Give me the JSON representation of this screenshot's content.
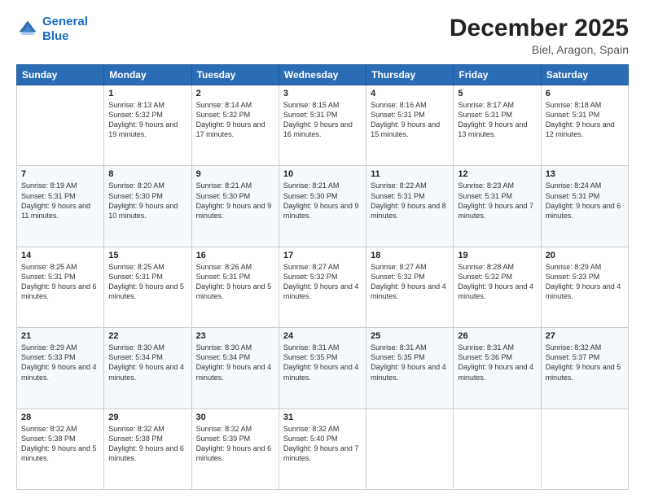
{
  "logo": {
    "line1": "General",
    "line2": "Blue"
  },
  "title": "December 2025",
  "subtitle": "Biel, Aragon, Spain",
  "days_header": [
    "Sunday",
    "Monday",
    "Tuesday",
    "Wednesday",
    "Thursday",
    "Friday",
    "Saturday"
  ],
  "weeks": [
    [
      {
        "day": "",
        "sunrise": "",
        "sunset": "",
        "daylight": ""
      },
      {
        "day": "1",
        "sunrise": "Sunrise: 8:13 AM",
        "sunset": "Sunset: 5:32 PM",
        "daylight": "Daylight: 9 hours and 19 minutes."
      },
      {
        "day": "2",
        "sunrise": "Sunrise: 8:14 AM",
        "sunset": "Sunset: 5:32 PM",
        "daylight": "Daylight: 9 hours and 17 minutes."
      },
      {
        "day": "3",
        "sunrise": "Sunrise: 8:15 AM",
        "sunset": "Sunset: 5:31 PM",
        "daylight": "Daylight: 9 hours and 16 minutes."
      },
      {
        "day": "4",
        "sunrise": "Sunrise: 8:16 AM",
        "sunset": "Sunset: 5:31 PM",
        "daylight": "Daylight: 9 hours and 15 minutes."
      },
      {
        "day": "5",
        "sunrise": "Sunrise: 8:17 AM",
        "sunset": "Sunset: 5:31 PM",
        "daylight": "Daylight: 9 hours and 13 minutes."
      },
      {
        "day": "6",
        "sunrise": "Sunrise: 8:18 AM",
        "sunset": "Sunset: 5:31 PM",
        "daylight": "Daylight: 9 hours and 12 minutes."
      }
    ],
    [
      {
        "day": "7",
        "sunrise": "Sunrise: 8:19 AM",
        "sunset": "Sunset: 5:31 PM",
        "daylight": "Daylight: 9 hours and 11 minutes."
      },
      {
        "day": "8",
        "sunrise": "Sunrise: 8:20 AM",
        "sunset": "Sunset: 5:30 PM",
        "daylight": "Daylight: 9 hours and 10 minutes."
      },
      {
        "day": "9",
        "sunrise": "Sunrise: 8:21 AM",
        "sunset": "Sunset: 5:30 PM",
        "daylight": "Daylight: 9 hours and 9 minutes."
      },
      {
        "day": "10",
        "sunrise": "Sunrise: 8:21 AM",
        "sunset": "Sunset: 5:30 PM",
        "daylight": "Daylight: 9 hours and 9 minutes."
      },
      {
        "day": "11",
        "sunrise": "Sunrise: 8:22 AM",
        "sunset": "Sunset: 5:31 PM",
        "daylight": "Daylight: 9 hours and 8 minutes."
      },
      {
        "day": "12",
        "sunrise": "Sunrise: 8:23 AM",
        "sunset": "Sunset: 5:31 PM",
        "daylight": "Daylight: 9 hours and 7 minutes."
      },
      {
        "day": "13",
        "sunrise": "Sunrise: 8:24 AM",
        "sunset": "Sunset: 5:31 PM",
        "daylight": "Daylight: 9 hours and 6 minutes."
      }
    ],
    [
      {
        "day": "14",
        "sunrise": "Sunrise: 8:25 AM",
        "sunset": "Sunset: 5:31 PM",
        "daylight": "Daylight: 9 hours and 6 minutes."
      },
      {
        "day": "15",
        "sunrise": "Sunrise: 8:25 AM",
        "sunset": "Sunset: 5:31 PM",
        "daylight": "Daylight: 9 hours and 5 minutes."
      },
      {
        "day": "16",
        "sunrise": "Sunrise: 8:26 AM",
        "sunset": "Sunset: 5:31 PM",
        "daylight": "Daylight: 9 hours and 5 minutes."
      },
      {
        "day": "17",
        "sunrise": "Sunrise: 8:27 AM",
        "sunset": "Sunset: 5:32 PM",
        "daylight": "Daylight: 9 hours and 4 minutes."
      },
      {
        "day": "18",
        "sunrise": "Sunrise: 8:27 AM",
        "sunset": "Sunset: 5:32 PM",
        "daylight": "Daylight: 9 hours and 4 minutes."
      },
      {
        "day": "19",
        "sunrise": "Sunrise: 8:28 AM",
        "sunset": "Sunset: 5:32 PM",
        "daylight": "Daylight: 9 hours and 4 minutes."
      },
      {
        "day": "20",
        "sunrise": "Sunrise: 8:29 AM",
        "sunset": "Sunset: 5:33 PM",
        "daylight": "Daylight: 9 hours and 4 minutes."
      }
    ],
    [
      {
        "day": "21",
        "sunrise": "Sunrise: 8:29 AM",
        "sunset": "Sunset: 5:33 PM",
        "daylight": "Daylight: 9 hours and 4 minutes."
      },
      {
        "day": "22",
        "sunrise": "Sunrise: 8:30 AM",
        "sunset": "Sunset: 5:34 PM",
        "daylight": "Daylight: 9 hours and 4 minutes."
      },
      {
        "day": "23",
        "sunrise": "Sunrise: 8:30 AM",
        "sunset": "Sunset: 5:34 PM",
        "daylight": "Daylight: 9 hours and 4 minutes."
      },
      {
        "day": "24",
        "sunrise": "Sunrise: 8:31 AM",
        "sunset": "Sunset: 5:35 PM",
        "daylight": "Daylight: 9 hours and 4 minutes."
      },
      {
        "day": "25",
        "sunrise": "Sunrise: 8:31 AM",
        "sunset": "Sunset: 5:35 PM",
        "daylight": "Daylight: 9 hours and 4 minutes."
      },
      {
        "day": "26",
        "sunrise": "Sunrise: 8:31 AM",
        "sunset": "Sunset: 5:36 PM",
        "daylight": "Daylight: 9 hours and 4 minutes."
      },
      {
        "day": "27",
        "sunrise": "Sunrise: 8:32 AM",
        "sunset": "Sunset: 5:37 PM",
        "daylight": "Daylight: 9 hours and 5 minutes."
      }
    ],
    [
      {
        "day": "28",
        "sunrise": "Sunrise: 8:32 AM",
        "sunset": "Sunset: 5:38 PM",
        "daylight": "Daylight: 9 hours and 5 minutes."
      },
      {
        "day": "29",
        "sunrise": "Sunrise: 8:32 AM",
        "sunset": "Sunset: 5:38 PM",
        "daylight": "Daylight: 9 hours and 6 minutes."
      },
      {
        "day": "30",
        "sunrise": "Sunrise: 8:32 AM",
        "sunset": "Sunset: 5:39 PM",
        "daylight": "Daylight: 9 hours and 6 minutes."
      },
      {
        "day": "31",
        "sunrise": "Sunrise: 8:32 AM",
        "sunset": "Sunset: 5:40 PM",
        "daylight": "Daylight: 9 hours and 7 minutes."
      },
      {
        "day": "",
        "sunrise": "",
        "sunset": "",
        "daylight": ""
      },
      {
        "day": "",
        "sunrise": "",
        "sunset": "",
        "daylight": ""
      },
      {
        "day": "",
        "sunrise": "",
        "sunset": "",
        "daylight": ""
      }
    ]
  ]
}
